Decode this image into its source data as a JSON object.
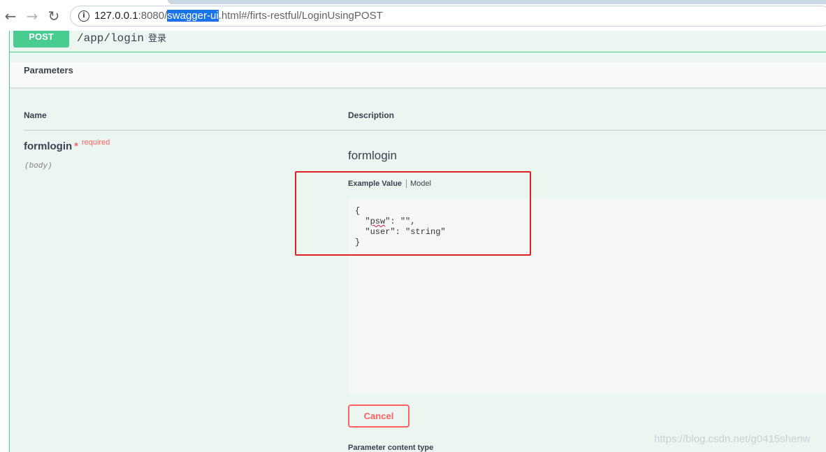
{
  "browser": {
    "back_icon": "←",
    "forward_icon": "→",
    "reload_icon": "↻",
    "info_icon": "i",
    "url_host": "127.0.0.1",
    "url_port": ":8080/",
    "url_selected": "swagger-ui",
    "url_rest": ".html#/firts-restful/LoginUsingPOST"
  },
  "operation": {
    "method": "POST",
    "path": "/app/login",
    "summary": "登录"
  },
  "parameters": {
    "title": "Parameters",
    "col_name": "Name",
    "col_description": "Description",
    "param_name": "formlogin",
    "required_star": "*",
    "required_label": "required",
    "param_in": "(body)",
    "field_label": "formlogin",
    "tab_example": "Example Value",
    "tab_model": "Model",
    "example_line1": "{",
    "example_line2_pre": "  \"",
    "example_line2_key": "psw",
    "example_line2_post": "\": \"\",",
    "example_line3": "  \"user\": \"string\"",
    "example_line4": "}",
    "cancel_label": "Cancel",
    "content_type_label": "Parameter content type"
  },
  "watermark": "https://blog.csdn.net/g0415shenw",
  "colors": {
    "post_green": "#49cc90",
    "panel_bg": "#ebf6f0",
    "cancel_red": "#ff6060",
    "highlight_red": "#e02020",
    "url_selection": "#1a73e8"
  }
}
